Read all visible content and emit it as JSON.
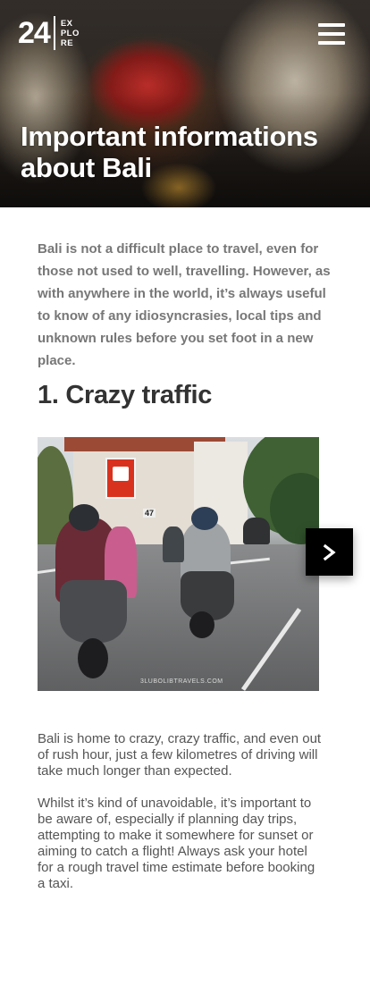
{
  "header": {
    "logo_number": "24",
    "logo_lines": [
      "EX",
      "PLO",
      "RE"
    ],
    "title": "Important informations about Bali"
  },
  "intro": "Bali is not a difficult place to travel, even for those not used to well, travelling. However, as with anywhere in the world, it’s always useful to know of any idiosyncrasies, local tips and unknown rules before you set foot in a new place.",
  "section": {
    "title": "1. Crazy traffic",
    "photo_watermark": "3LUBOLIBTRAVELS.COM",
    "photo_sign_number": "47",
    "next_label": ">",
    "paragraphs": [
      "Bali is home to crazy, crazy traffic, and even out of rush hour, just a few kilometres of driving will take much longer than expected.",
      "Whilst it’s kind of unavoidable, it’s important to be aware of, especially if planning day trips, attempting to make it somewhere for sunset or aiming to catch a flight! Always ask your hotel for a rough travel time estimate before booking a taxi."
    ]
  },
  "icons": {
    "menu": "hamburger-menu-icon",
    "next": "chevron-right-icon"
  },
  "colors": {
    "accent": "#000000",
    "text": "#555555",
    "heading": "#333333"
  }
}
